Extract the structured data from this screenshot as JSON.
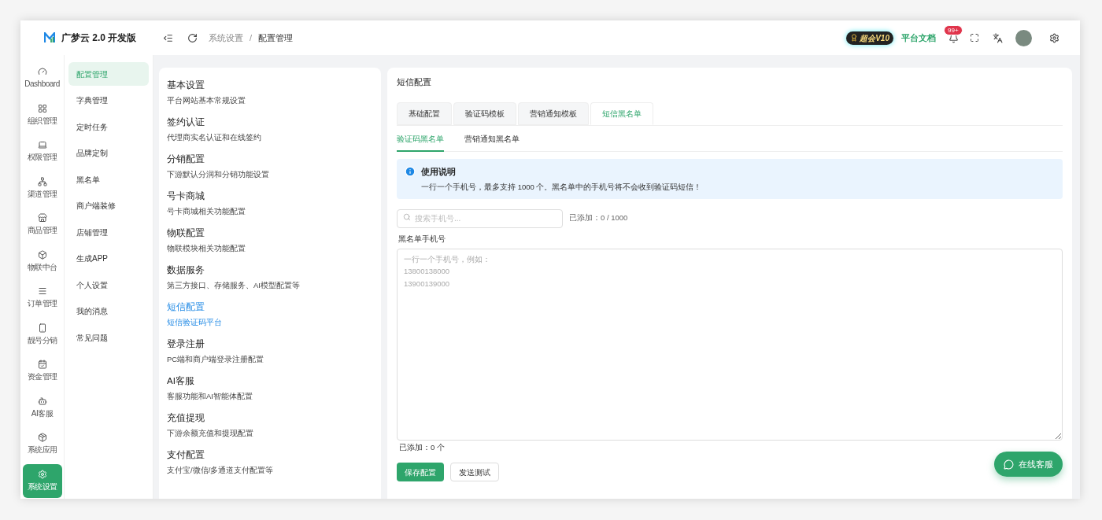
{
  "brand": {
    "title": "广梦云 2.0 开发版"
  },
  "breadcrumb": [
    "系统设置",
    "配置管理"
  ],
  "breadcrumb_separator": "/",
  "header": {
    "vip_badge": "超会V10",
    "docs_link": "平台文档",
    "notification_count": "99+"
  },
  "rail": [
    {
      "label": "Dashboard",
      "selected": false
    },
    {
      "label": "组织管理",
      "selected": false
    },
    {
      "label": "权限管理",
      "selected": false
    },
    {
      "label": "渠道管理",
      "selected": false
    },
    {
      "label": "商品管理",
      "selected": false
    },
    {
      "label": "物联中台",
      "selected": false
    },
    {
      "label": "订单管理",
      "selected": false
    },
    {
      "label": "靓号分销",
      "selected": false
    },
    {
      "label": "资金管理",
      "selected": false
    },
    {
      "label": "AI客服",
      "selected": false
    },
    {
      "label": "系统应用",
      "selected": false
    },
    {
      "label": "系统设置",
      "selected": true
    }
  ],
  "submenu": [
    {
      "label": "配置管理",
      "selected": true
    },
    {
      "label": "字典管理",
      "selected": false
    },
    {
      "label": "定时任务",
      "selected": false
    },
    {
      "label": "品牌定制",
      "selected": false
    },
    {
      "label": "黑名单",
      "selected": false
    },
    {
      "label": "商户端装修",
      "selected": false
    },
    {
      "label": "店铺管理",
      "selected": false
    },
    {
      "label": "生成APP",
      "selected": false
    },
    {
      "label": "个人设置",
      "selected": false
    },
    {
      "label": "我的消息",
      "selected": false
    },
    {
      "label": "常见问题",
      "selected": false
    }
  ],
  "config_sections": [
    {
      "title": "基本设置",
      "description": "平台网站基本常规设置",
      "selected": false
    },
    {
      "title": "签约认证",
      "description": "代理商实名认证和在线签约",
      "selected": false
    },
    {
      "title": "分销配置",
      "description": "下游默认分润和分销功能设置",
      "selected": false
    },
    {
      "title": "号卡商城",
      "description": "号卡商城相关功能配置",
      "selected": false
    },
    {
      "title": "物联配置",
      "description": "物联模块相关功能配置",
      "selected": false
    },
    {
      "title": "数据服务",
      "description": "第三方接口、存储服务、AI模型配置等",
      "selected": false
    },
    {
      "title": "短信配置",
      "description": "短信验证码平台",
      "selected": true
    },
    {
      "title": "登录注册",
      "description": "PC端和商户端登录注册配置",
      "selected": false
    },
    {
      "title": "AI客服",
      "description": "客服功能和AI智能体配置",
      "selected": false
    },
    {
      "title": "充值提现",
      "description": "下游余额充值和提现配置",
      "selected": false
    },
    {
      "title": "支付配置",
      "description": "支付宝/微信/多通道支付配置等",
      "selected": false
    }
  ],
  "panel": {
    "title": "短信配置",
    "tabs": [
      {
        "label": "基础配置",
        "selected": false
      },
      {
        "label": "验证码模板",
        "selected": false
      },
      {
        "label": "营销通知模板",
        "selected": false
      },
      {
        "label": "短信黑名单",
        "selected": true
      }
    ],
    "subtabs": [
      {
        "label": "验证码黑名单",
        "selected": true
      },
      {
        "label": "营销通知黑名单",
        "selected": false
      }
    ],
    "notice": {
      "title": "使用说明",
      "text": "一行一个手机号，最多支持 1000 个。黑名单中的手机号将不会收到验证码短信！"
    },
    "search": {
      "placeholder": "搜索手机号..."
    },
    "added_total": "已添加：0 / 1000",
    "field_label": "黑名单手机号",
    "textarea": {
      "placeholder": "一行一个手机号，例如：\n13800138000\n13900139000"
    },
    "added_count": "已添加：0 个",
    "buttons": [
      {
        "label": "保存配置",
        "kind": "primary"
      },
      {
        "label": "发送测试",
        "kind": "secondary"
      }
    ]
  },
  "chat_button": "在线客服"
}
